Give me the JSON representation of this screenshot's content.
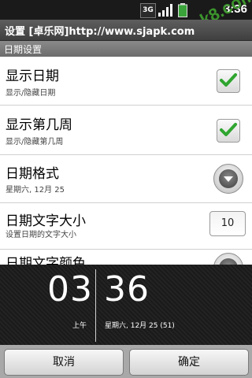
{
  "statusbar": {
    "network": "3G",
    "time": "3:36",
    "watermark": "apk8.com"
  },
  "titlebar": {
    "title": "设置 [卓乐网]http://www.sjapk.com"
  },
  "section": {
    "label": "日期设置"
  },
  "prefs": [
    {
      "title": "显示日期",
      "summary": "显示/隐藏日期",
      "control": "checkbox",
      "checked": true
    },
    {
      "title": "显示第几周",
      "summary": "显示/隐藏第几周",
      "control": "checkbox",
      "checked": true
    },
    {
      "title": "日期格式",
      "summary": "星期六, 12月 25",
      "control": "dropdown"
    },
    {
      "title": "日期文字大小",
      "summary": "设置日期的文字大小",
      "control": "number",
      "value": "10"
    },
    {
      "title": "日期文字颜色",
      "summary": "",
      "control": "dropdown"
    }
  ],
  "clock": {
    "hour": "03",
    "minute": "36",
    "ampm": "上午",
    "date": "星期六, 12月 25 (51)"
  },
  "buttons": {
    "cancel": "取消",
    "confirm": "确定"
  },
  "colors": {
    "check_green": "#2fa52f",
    "title_bg": "#4a4a4a",
    "section_bg": "#7a7a7a"
  }
}
